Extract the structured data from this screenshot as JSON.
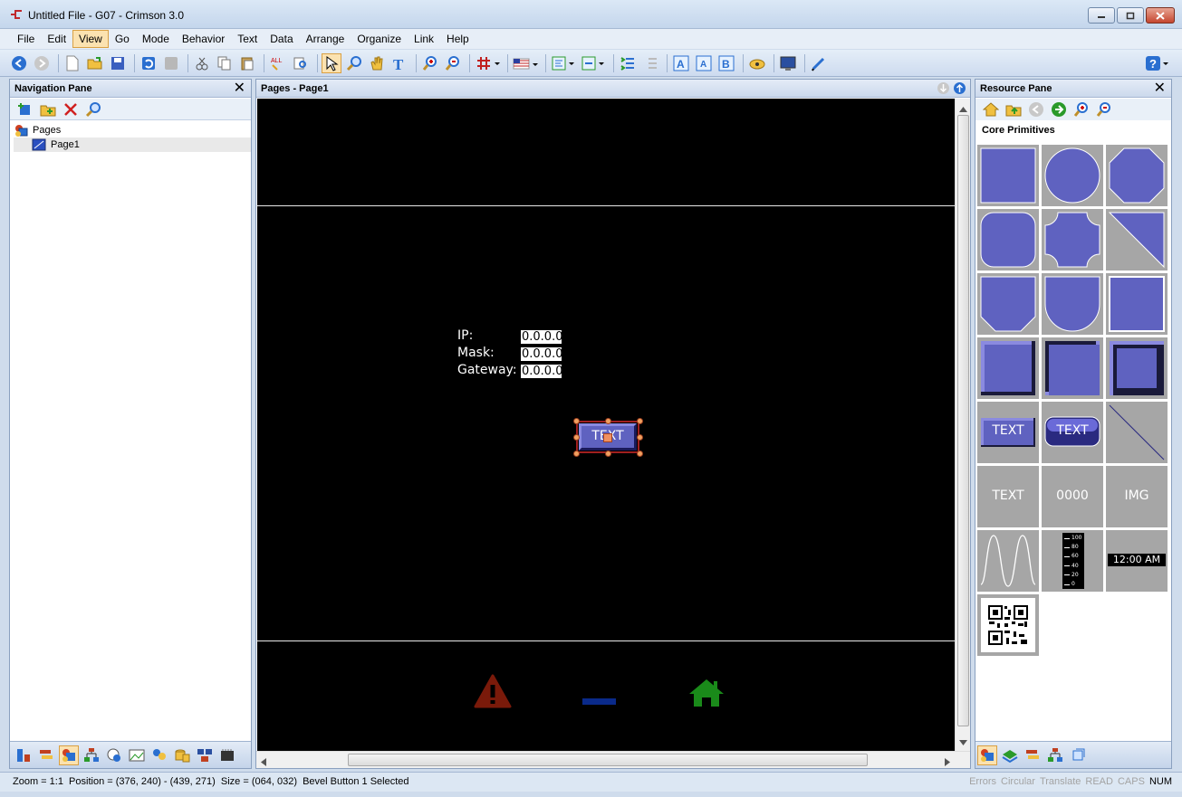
{
  "window": {
    "title": "Untitled File - G07 - Crimson 3.0"
  },
  "menu": [
    "File",
    "Edit",
    "View",
    "Go",
    "Mode",
    "Behavior",
    "Text",
    "Data",
    "Arrange",
    "Organize",
    "Link",
    "Help"
  ],
  "menu_active": "View",
  "navigation_pane": {
    "title": "Navigation Pane",
    "tree": [
      {
        "label": "Pages",
        "level": 0
      },
      {
        "label": "Page1",
        "level": 1,
        "selected": true
      }
    ]
  },
  "page_pane": {
    "title": "Pages - Page1",
    "labels": {
      "ip": "IP:",
      "mask": "Mask:",
      "gateway": "Gateway:"
    },
    "values": {
      "ip": "0.0.0.0",
      "mask": "0.0.0.0",
      "gateway": "0.0.0.0"
    },
    "button_text": "TEXT"
  },
  "resource_pane": {
    "title": "Resource Pane",
    "section": "Core Primitives",
    "primitive_texts": {
      "text_btn1": "TEXT",
      "text_btn2": "TEXT",
      "text": "TEXT",
      "number": "0000",
      "img": "IMG",
      "clock": "12:00 AM"
    },
    "scale_ticks": [
      "100",
      "80",
      "60",
      "40",
      "20",
      "0"
    ]
  },
  "status": {
    "left": "Zoom = 1:1  Position = (376, 240) - (439, 271)  Size = (064, 032)  Bevel Button 1 Selected",
    "indicators": [
      {
        "label": "Errors",
        "on": false
      },
      {
        "label": "Circular",
        "on": false
      },
      {
        "label": "Translate",
        "on": false
      },
      {
        "label": "READ",
        "on": false
      },
      {
        "label": "CAPS",
        "on": false
      },
      {
        "label": "NUM",
        "on": true
      }
    ]
  },
  "colors": {
    "primitive_fill": "#5f62c0",
    "canvas": "#000000",
    "warning": "#7a1a0a",
    "home": "#1a8a1a",
    "dash": "#0a2a8a"
  }
}
